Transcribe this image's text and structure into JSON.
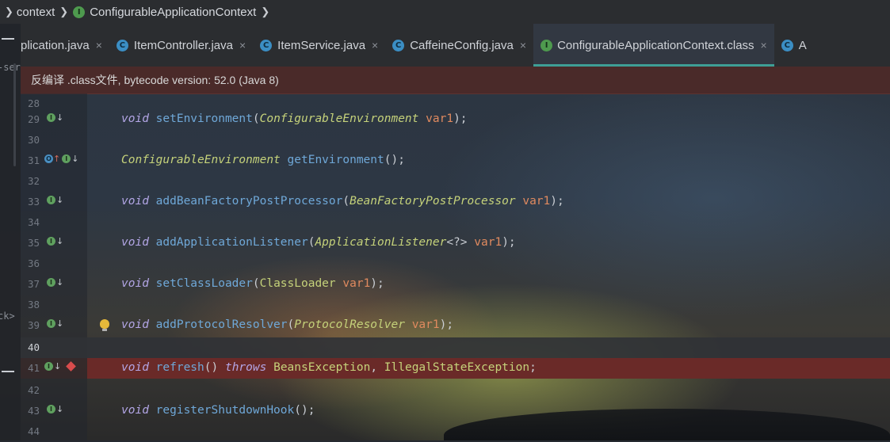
{
  "breadcrumb": {
    "items": [
      "context",
      "ConfigurableApplicationContext"
    ],
    "badge_letter": "I"
  },
  "left_strip": {
    "text_top": "-ser",
    "text_mid": "ck>"
  },
  "tabs": [
    {
      "label": "plication.java",
      "icon": "c-class-icon",
      "active": false
    },
    {
      "label": "ItemController.java",
      "icon": "c-class-icon",
      "active": false
    },
    {
      "label": "ItemService.java",
      "icon": "c-class-icon",
      "active": false
    },
    {
      "label": "CaffeineConfig.java",
      "icon": "c-class-icon",
      "active": false
    },
    {
      "label": "ConfigurableApplicationContext.class",
      "icon": "interface-icon",
      "active": true
    },
    {
      "label": "A",
      "icon": "c-class-icon",
      "active": false
    }
  ],
  "tab_close": "×",
  "banner": {
    "text": "反编译 .class文件, bytecode version: 52.0 (Java 8)"
  },
  "editor": {
    "line_numbers": [
      "28",
      "29",
      "30",
      "31",
      "32",
      "33",
      "34",
      "35",
      "36",
      "37",
      "38",
      "39",
      "40",
      "41",
      "42",
      "43",
      "44"
    ],
    "code": {
      "l29": {
        "kw": "void",
        "fn": "setEnvironment",
        "open": "(",
        "ptype": "ConfigurableEnvironment",
        "param": "var1",
        "close": ");"
      },
      "l31": {
        "type": "ConfigurableEnvironment",
        "fn": "getEnvironment",
        "rest": "();"
      },
      "l33": {
        "kw": "void",
        "fn": "addBeanFactoryPostProcessor",
        "open": "(",
        "ptype": "BeanFactoryPostProcessor",
        "param": "var1",
        "close": ");"
      },
      "l35": {
        "kw": "void",
        "fn": "addApplicationListener",
        "open": "(",
        "ptype": "ApplicationListener",
        "generic": "<?>",
        "param": "var1",
        "close": ");"
      },
      "l37": {
        "kw": "void",
        "fn": "setClassLoader",
        "open": "(",
        "ptype": "ClassLoader",
        "param": "var1",
        "close": ");"
      },
      "l39": {
        "kw": "void",
        "fn": "addProtocolResolver",
        "open": "(",
        "ptype": "ProtocolResolver",
        "param": "var1",
        "close": ");"
      },
      "l41": {
        "kw": "void",
        "fn": "refresh",
        "paren": "() ",
        "throws": "throws",
        "ex1": "BeansException",
        "comma": ", ",
        "ex2": "IllegalStateException",
        "end": ";"
      },
      "l43": {
        "kw": "void",
        "fn": "registerShutdownHook",
        "rest": "();"
      }
    },
    "gutter": {
      "impl_letter": "I",
      "over_letter": "O",
      "down_arrow": "↓",
      "up_arrow": "↑"
    },
    "colors": {
      "keyword": "#b3a6e6",
      "method": "#6fa8d8",
      "type": "#c5d27a",
      "param": "#e08a5f",
      "breakpoint_line": "#6a2a28",
      "active_tab_underline": "#3e9e95"
    }
  }
}
